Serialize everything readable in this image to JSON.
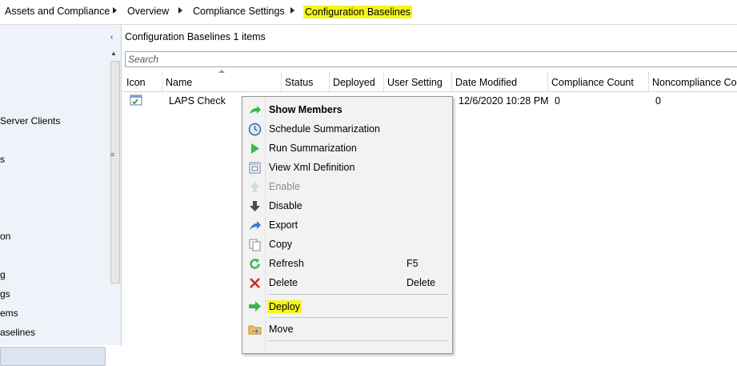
{
  "breadcrumb": {
    "items": [
      "Assets and Compliance",
      "Overview",
      "Compliance Settings",
      "Configuration Baselines"
    ],
    "highlight_color": "#f6f51a"
  },
  "left_nav": {
    "collapse_glyph": "‹",
    "items": [
      {
        "label": "Server Clients"
      },
      {
        "label": "s"
      },
      {
        "label": "on"
      },
      {
        "label": "g"
      },
      {
        "label": "gs"
      },
      {
        "label": "ems"
      },
      {
        "label": "aselines",
        "selected": true
      }
    ]
  },
  "main": {
    "title": "Configuration Baselines",
    "count": "1 items",
    "search_placeholder": "Search",
    "columns": [
      "Icon",
      "Name",
      "Status",
      "Deployed",
      "User Setting",
      "Date Modified",
      "Compliance Count",
      "Noncompliance Cou"
    ],
    "rows": [
      {
        "icon": "configuration-baseline-icon",
        "name": "LAPS Check",
        "date_modified": "12/6/2020 10:28 PM",
        "compliance_count": "0",
        "noncompliance_count": "0"
      }
    ]
  },
  "context_menu": {
    "items": [
      {
        "label": "Show Members",
        "icon": "arrow-right-green-icon",
        "bold": true
      },
      {
        "label": "Schedule Summarization",
        "icon": "clock-icon"
      },
      {
        "label": "Run Summarization",
        "icon": "play-icon"
      },
      {
        "label": "View Xml Definition",
        "icon": "xml-document-icon"
      },
      {
        "label": "Enable",
        "icon": "arrow-up-icon",
        "disabled": true
      },
      {
        "label": "Disable",
        "icon": "arrow-down-icon"
      },
      {
        "label": "Export",
        "icon": "export-arrow-icon"
      },
      {
        "label": "Copy",
        "icon": "copy-icon"
      },
      {
        "label": "Refresh",
        "icon": "refresh-icon",
        "shortcut": "F5"
      },
      {
        "label": "Delete",
        "icon": "delete-x-icon",
        "shortcut": "Delete"
      },
      {
        "label": "Deploy",
        "icon": "deploy-arrow-icon",
        "highlighted": true
      },
      {
        "label": "Move",
        "icon": "folder-move-icon"
      }
    ]
  },
  "colors": {
    "highlight": "#f6f51a",
    "left_pane_bg": "#eef2f9",
    "menu_bg": "#f2f2f2",
    "green_icon": "#3cb54a",
    "blue_icon": "#2f7bd8",
    "red_icon": "#d42b2b"
  }
}
